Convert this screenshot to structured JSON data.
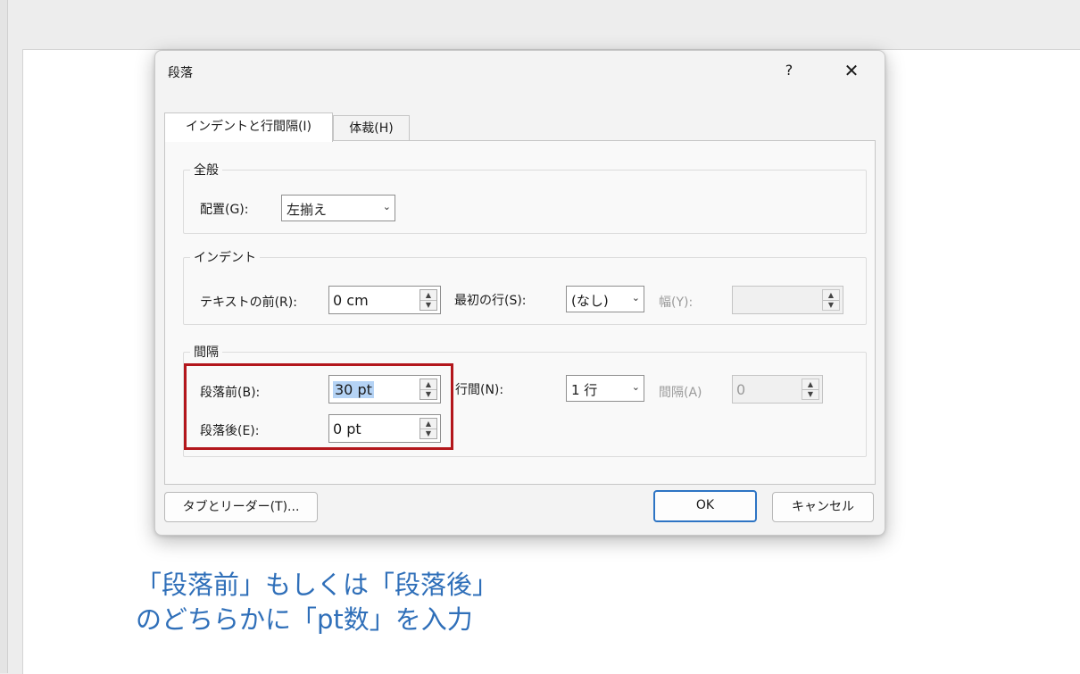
{
  "dialog": {
    "title": "段落",
    "help_label": "?",
    "close_label": "✕"
  },
  "tabs": [
    {
      "label": "インデントと行間隔(I)",
      "active": true
    },
    {
      "label": "体裁(H)",
      "active": false
    }
  ],
  "general": {
    "title": "全般",
    "alignment_label": "配置(G):",
    "alignment_value": "左揃え"
  },
  "indent": {
    "title": "インデント",
    "before_text_label": "テキストの前(R):",
    "before_text_value": "0 cm",
    "first_line_label": "最初の行(S):",
    "first_line_value": "(なし)",
    "width_label": "幅(Y):",
    "width_value": ""
  },
  "spacing": {
    "title": "間隔",
    "before_label": "段落前(B):",
    "before_value": "30 pt",
    "after_label": "段落後(E):",
    "after_value": "0 pt",
    "line_spacing_label": "行間(N):",
    "line_spacing_value": "1 行",
    "at_label": "間隔(A)",
    "at_value": "0"
  },
  "buttons": {
    "tabs_leaders": "タブとリーダー(T)...",
    "ok": "OK",
    "cancel": "キャンセル"
  },
  "annotation": {
    "line1": "「段落前」もしくは「段落後」",
    "line2": "のどちらかに「pt数」を入力",
    "highlight_color": "#b3171c",
    "text_color": "#2f6fb9"
  },
  "icons": {
    "dropdown": "chevron-down-icon",
    "spin_up": "caret-up-icon",
    "spin_down": "caret-down-icon",
    "close": "close-icon"
  }
}
